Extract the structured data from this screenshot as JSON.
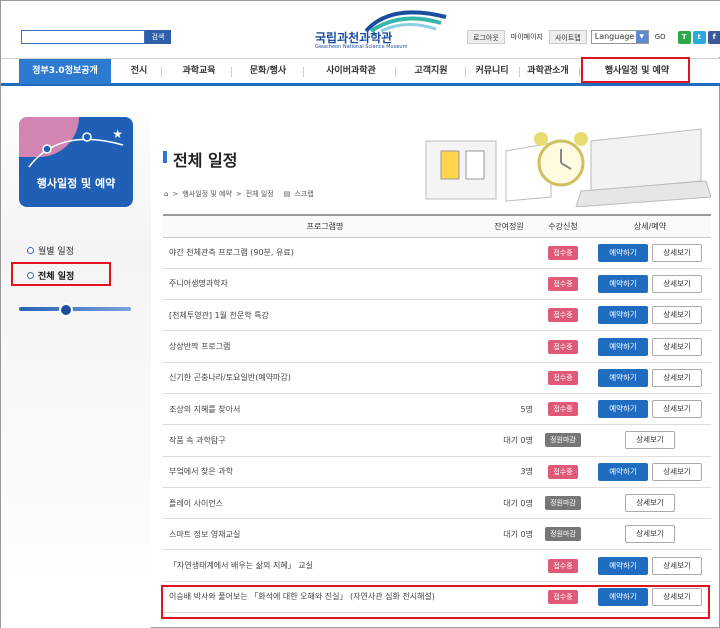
{
  "header": {
    "search_button": "검색",
    "logo_title": "국립과천과학관",
    "logo_subtitle": "Gwacheon National Science Museum",
    "links": [
      "로그아웃",
      "마이페이지",
      "사이트맵"
    ],
    "language_select": "Language",
    "go_label": "GO"
  },
  "nav": {
    "items": [
      "정부3.0정보공개",
      "전시",
      "과학교육",
      "문화/행사",
      "사이버과학관",
      "고객지원",
      "커뮤니티",
      "과학관소개",
      "행사일정 및 예약"
    ]
  },
  "sidebar": {
    "badge_label": "행사일정 및 예약",
    "items": [
      "월별 일정",
      "전체 일정"
    ]
  },
  "content": {
    "title": "전체 일정",
    "breadcrumb": [
      "행사일정 및 예약",
      "전체 일정"
    ],
    "scrap_label": "스크랩",
    "table": {
      "headers": [
        "프로그램명",
        "잔여정원",
        "수강신청",
        "상세/예약"
      ],
      "rows": [
        {
          "name": "야간 천체관측 프로그램 (90분, 유료)",
          "seats": "",
          "status": "접수중",
          "reserve": "예약하기",
          "detail": "상세보기"
        },
        {
          "name": "주니어생명과학자",
          "seats": "",
          "status": "접수중",
          "reserve": "예약하기",
          "detail": "상세보기"
        },
        {
          "name": "[천체투영관] 1월 천문학 특강",
          "seats": "",
          "status": "접수중",
          "reserve": "예약하기",
          "detail": "상세보기"
        },
        {
          "name": "상상반짝 프로그램",
          "seats": "",
          "status": "접수중",
          "reserve": "예약하기",
          "detail": "상세보기"
        },
        {
          "name": "신기한 곤충나라/토요일반(예약마감)",
          "seats": "",
          "status": "접수중",
          "reserve": "예약하기",
          "detail": "상세보기"
        },
        {
          "name": "조상의 지혜를 찾아서",
          "seats": "5명",
          "status": "접수중",
          "reserve": "예약하기",
          "detail": "상세보기"
        },
        {
          "name": "작품 속 과학탐구",
          "seats": "대기 0명",
          "status": "정원마감",
          "reserve": "",
          "detail": "상세보기"
        },
        {
          "name": "부엌에서 찾은 과학",
          "seats": "3명",
          "status": "접수중",
          "reserve": "예약하기",
          "detail": "상세보기"
        },
        {
          "name": "플레이 사이언스",
          "seats": "대기 0명",
          "status": "정원마감",
          "reserve": "",
          "detail": "상세보기"
        },
        {
          "name": "스마트 정보 영재교실",
          "seats": "대기 0명",
          "status": "정원마감",
          "reserve": "",
          "detail": "상세보기"
        },
        {
          "name": "「자연생태계에서 배우는 삶의 지혜」 교실",
          "seats": "",
          "status": "접수중",
          "reserve": "예약하기",
          "detail": "상세보기"
        },
        {
          "name": "이승배 박사와 풀어보는 「화석에 대한 오해와 진실」 (자연사관 심화 전시해설)",
          "seats": "",
          "status": "접수중",
          "reserve": "예약하기",
          "detail": "상세보기"
        }
      ]
    }
  },
  "colors": {
    "accent": "#1f6cc0",
    "highlight": "#e0141e",
    "open_badge": "#e05a78",
    "closed_badge": "#777777"
  }
}
